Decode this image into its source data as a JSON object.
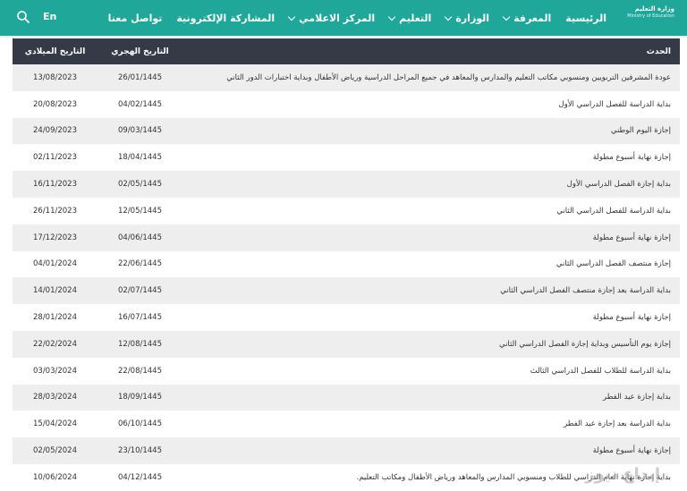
{
  "header": {
    "lang_label": "En",
    "logo_line1": "وزارة التعليم",
    "logo_line2": "Ministry of Education",
    "nav": [
      {
        "label": "الرئيسية",
        "has_menu": false
      },
      {
        "label": "المعرفة",
        "has_menu": true
      },
      {
        "label": "الوزارة",
        "has_menu": true
      },
      {
        "label": "التعليم",
        "has_menu": true
      },
      {
        "label": "المركز الاعلامي",
        "has_menu": true
      },
      {
        "label": "المشاركة الإلكترونية",
        "has_menu": false
      },
      {
        "label": "تواصل معنا",
        "has_menu": false
      }
    ]
  },
  "table": {
    "headers": {
      "event": "الحدث",
      "hijri": "التاريخ الهجري",
      "greg": "التاريخ الميلادي"
    },
    "rows": [
      {
        "event": "عودة المشرفين التربويين ومنسوبي مكاتب التعليم والمدارس والمعاهد في جميع المراحل الدراسية ورياض الأطفال وبداية اختبارات الدور الثاني",
        "hijri": "26/01/1445",
        "greg": "13/08/2023"
      },
      {
        "event": "بداية الدراسة للفصل الدراسي الأول",
        "hijri": "04/02/1445",
        "greg": "20/08/2023"
      },
      {
        "event": "إجازة اليوم الوطني",
        "hijri": "09/03/1445",
        "greg": "24/09/2023"
      },
      {
        "event": "إجازة نهاية أسبوع مطولة",
        "hijri": "18/04/1445",
        "greg": "02/11/2023"
      },
      {
        "event": "بداية إجازة الفصل الدراسي الأول",
        "hijri": "02/05/1445",
        "greg": "16/11/2023"
      },
      {
        "event": "بداية الدراسة للفصل الدراسي الثاني",
        "hijri": "12/05/1445",
        "greg": "26/11/2023"
      },
      {
        "event": "إجازة نهاية أسبوع مطولة",
        "hijri": "04/06/1445",
        "greg": "17/12/2023"
      },
      {
        "event": "إجازة منتصف الفصل الدراسي الثاني",
        "hijri": "22/06/1445",
        "greg": "04/01/2024"
      },
      {
        "event": "بداية الدراسة بعد إجازة منتصف الفصل الدراسي الثاني",
        "hijri": "02/07/1445",
        "greg": "14/01/2024"
      },
      {
        "event": "إجازة نهاية أسبوع مطولة",
        "hijri": "16/07/1445",
        "greg": "28/01/2024"
      },
      {
        "event": "إجازة يوم التأسيس وبداية إجازة الفصل الدراسي الثاني",
        "hijri": "12/08/1445",
        "greg": "22/02/2024"
      },
      {
        "event": "بداية الدراسة للطلاب للفصل الدراسي الثالث",
        "hijri": "22/08/1445",
        "greg": "03/03/2024"
      },
      {
        "event": "بداية إجازة عيد الفطر",
        "hijri": "18/09/1445",
        "greg": "28/03/2024"
      },
      {
        "event": "بداية الدراسة بعد إجازة عيد الفطر",
        "hijri": "06/10/1445",
        "greg": "15/04/2024"
      },
      {
        "event": "إجازة نهاية أسبوع مطولة",
        "hijri": "23/10/1445",
        "greg": "02/05/2024"
      },
      {
        "event": "بداية إجازة نهاية العام الدراسي للطلاب ومنسوبي المدارس والمعاهد ورياض الأطفال ومكاتب التعليم.",
        "hijri": "04/12/1445",
        "greg": "10/06/2024"
      }
    ]
  },
  "watermark": {
    "text": "إبداع نيوز"
  },
  "colors": {
    "topbar": "#1fa79a",
    "header_row": "#343b46",
    "alt_row": "#eeeeee"
  }
}
